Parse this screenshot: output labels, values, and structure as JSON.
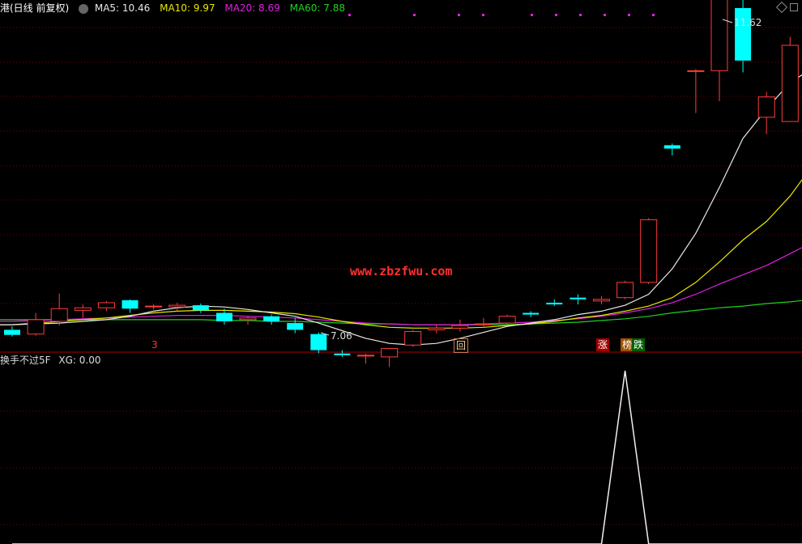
{
  "header": {
    "title": "港(日线 前复权)",
    "ma5": "MA5: 10.46",
    "ma10": "MA10: 9.97",
    "ma20": "MA20: 8.69",
    "ma60": "MA60: 7.88"
  },
  "sub_header": {
    "name": "换手不过5F",
    "xg": "XG: 0.00"
  },
  "watermark": "www.zbzfwu.com",
  "tags": {
    "t1": "3",
    "t2": "回",
    "t3": "涨",
    "t4": "榜",
    "t5": "跌"
  },
  "colors": {
    "up": "#ff3c3c",
    "down": "#00ffff",
    "ma5": "#e8e8e8",
    "ma10": "#e8e800",
    "ma20": "#e020e0",
    "ma60": "#20d020",
    "grid": "#7a0000"
  },
  "chart_data": {
    "type": "candlestick",
    "price_high_label": "11.62",
    "price_low_label": "7.06",
    "ohlc": [
      [
        7.5,
        7.54,
        7.42,
        7.44
      ],
      [
        7.45,
        7.7,
        7.43,
        7.62
      ],
      [
        7.6,
        7.93,
        7.55,
        7.75
      ],
      [
        7.73,
        7.8,
        7.64,
        7.76
      ],
      [
        7.76,
        7.84,
        7.72,
        7.82
      ],
      [
        7.85,
        7.86,
        7.7,
        7.75
      ],
      [
        7.78,
        7.8,
        7.74,
        7.78
      ],
      [
        7.77,
        7.82,
        7.72,
        7.79
      ],
      [
        7.79,
        7.81,
        7.7,
        7.73
      ],
      [
        7.7,
        7.75,
        7.56,
        7.6
      ],
      [
        7.62,
        7.66,
        7.56,
        7.64
      ],
      [
        7.66,
        7.68,
        7.56,
        7.6
      ],
      [
        7.58,
        7.64,
        7.46,
        7.5
      ],
      [
        7.45,
        7.47,
        7.22,
        7.26
      ],
      [
        7.22,
        7.26,
        7.18,
        7.2
      ],
      [
        7.19,
        7.22,
        7.1,
        7.2
      ],
      [
        7.18,
        7.28,
        7.06,
        7.28
      ],
      [
        7.32,
        7.5,
        7.3,
        7.48
      ],
      [
        7.5,
        7.56,
        7.46,
        7.52
      ],
      [
        7.52,
        7.62,
        7.48,
        7.55
      ],
      [
        7.56,
        7.64,
        7.53,
        7.57
      ],
      [
        7.58,
        7.68,
        7.56,
        7.66
      ],
      [
        7.7,
        7.72,
        7.65,
        7.68
      ],
      [
        7.82,
        7.86,
        7.78,
        7.8
      ],
      [
        7.88,
        7.92,
        7.8,
        7.86
      ],
      [
        7.84,
        7.9,
        7.8,
        7.86
      ],
      [
        7.88,
        8.08,
        7.86,
        8.06
      ],
      [
        8.06,
        8.82,
        8.04,
        8.8
      ],
      [
        9.68,
        9.7,
        9.56,
        9.64
      ],
      [
        10.56,
        10.58,
        10.06,
        10.56
      ],
      [
        10.56,
        11.58,
        10.2,
        11.52
      ],
      [
        11.3,
        11.4,
        10.54,
        10.68
      ],
      [
        10.01,
        10.31,
        9.81,
        10.25
      ],
      [
        9.96,
        10.96,
        9.96,
        10.86
      ],
      [
        10.46,
        11.38,
        10.46,
        11.4
      ],
      [
        10.9,
        11.62,
        10.46,
        11.12
      ]
    ],
    "ma_series": {
      "ma5": [
        7.56,
        7.57,
        7.58,
        7.6,
        7.62,
        7.66,
        7.72,
        7.76,
        7.78,
        7.77,
        7.74,
        7.7,
        7.66,
        7.58,
        7.49,
        7.4,
        7.34,
        7.32,
        7.34,
        7.4,
        7.47,
        7.54,
        7.58,
        7.62,
        7.68,
        7.72,
        7.79,
        7.92,
        8.22,
        8.64,
        9.18,
        9.76,
        10.11,
        10.42,
        10.6,
        10.46
      ],
      "ma10": [
        7.56,
        7.58,
        7.6,
        7.62,
        7.64,
        7.67,
        7.7,
        7.72,
        7.73,
        7.73,
        7.72,
        7.71,
        7.69,
        7.65,
        7.6,
        7.56,
        7.53,
        7.52,
        7.52,
        7.52,
        7.53,
        7.55,
        7.57,
        7.6,
        7.64,
        7.67,
        7.72,
        7.78,
        7.88,
        8.06,
        8.3,
        8.56,
        8.78,
        9.08,
        9.46,
        9.97
      ],
      "ma20": [
        7.6,
        7.61,
        7.62,
        7.63,
        7.64,
        7.65,
        7.66,
        7.67,
        7.67,
        7.67,
        7.66,
        7.65,
        7.64,
        7.62,
        7.6,
        7.58,
        7.57,
        7.56,
        7.56,
        7.56,
        7.57,
        7.58,
        7.59,
        7.61,
        7.63,
        7.66,
        7.7,
        7.75,
        7.82,
        7.92,
        8.04,
        8.15,
        8.26,
        8.4,
        8.54,
        8.69
      ],
      "ma60": [
        7.62,
        7.62,
        7.62,
        7.62,
        7.62,
        7.62,
        7.62,
        7.62,
        7.62,
        7.61,
        7.61,
        7.6,
        7.6,
        7.59,
        7.58,
        7.57,
        7.57,
        7.56,
        7.56,
        7.56,
        7.56,
        7.56,
        7.57,
        7.58,
        7.59,
        7.61,
        7.63,
        7.66,
        7.7,
        7.73,
        7.76,
        7.78,
        7.81,
        7.83,
        7.86,
        7.88
      ]
    },
    "indicator": {
      "name": "XG",
      "values": [
        0,
        0,
        0,
        0,
        0,
        0,
        0,
        0,
        0,
        0,
        0,
        0,
        0,
        0,
        0,
        0,
        0,
        0,
        0,
        0,
        0,
        0,
        0,
        0,
        0,
        0,
        1,
        0,
        0,
        0,
        0,
        0,
        0,
        0,
        0,
        0
      ]
    }
  }
}
